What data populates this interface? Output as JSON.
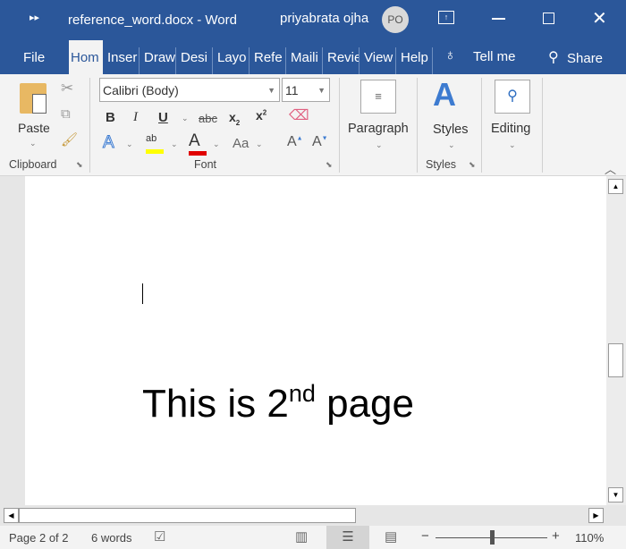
{
  "titlebar": {
    "title": "reference_word.docx  -  Word",
    "user": "priyabrata ojha",
    "initials": "PO"
  },
  "tabs": [
    "File",
    "Hom",
    "Inser",
    "Draw",
    "Desi",
    "Layo",
    "Refe",
    "Maili",
    "Revie",
    "View",
    "Help"
  ],
  "tell_me": "Tell me",
  "share": "Share",
  "ribbon": {
    "paste": "Paste",
    "clipboard": "Clipboard",
    "font_name": "Calibri (Body)",
    "font_size": "11",
    "font": "Font",
    "paragraph": "Paragraph",
    "styles": "Styles",
    "styles_group": "Styles",
    "editing": "Editing",
    "bold": "B",
    "italic": "I",
    "underline": "U",
    "strike": "abc",
    "change_case": "Aa",
    "highlight_color": "#ffff00",
    "font_color": "#e00000"
  },
  "document": {
    "text_main": "This is 2",
    "text_sup": "nd",
    "text_end": " page"
  },
  "status": {
    "page": "Page 2 of 2",
    "words": "6 words",
    "zoom": "110%",
    "zoom_level": 110
  },
  "colors": {
    "brand": "#2b579a"
  }
}
